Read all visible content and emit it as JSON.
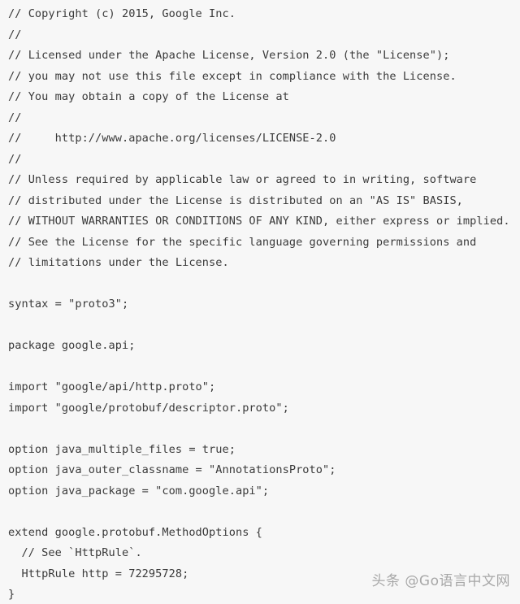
{
  "editor": {
    "language": "protobuf",
    "background_color": "#f7f7f7",
    "text_color": "#3a3a3a",
    "lines": [
      "// Copyright (c) 2015, Google Inc.",
      "//",
      "// Licensed under the Apache License, Version 2.0 (the \"License\");",
      "// you may not use this file except in compliance with the License.",
      "// You may obtain a copy of the License at",
      "//",
      "//     http://www.apache.org/licenses/LICENSE-2.0",
      "//",
      "// Unless required by applicable law or agreed to in writing, software",
      "// distributed under the License is distributed on an \"AS IS\" BASIS,",
      "// WITHOUT WARRANTIES OR CONDITIONS OF ANY KIND, either express or implied.",
      "// See the License for the specific language governing permissions and",
      "// limitations under the License.",
      "",
      "syntax = \"proto3\";",
      "",
      "package google.api;",
      "",
      "import \"google/api/http.proto\";",
      "import \"google/protobuf/descriptor.proto\";",
      "",
      "option java_multiple_files = true;",
      "option java_outer_classname = \"AnnotationsProto\";",
      "option java_package = \"com.google.api\";",
      "",
      "extend google.protobuf.MethodOptions {",
      "  // See `HttpRule`.",
      "  HttpRule http = 72295728;",
      "}"
    ]
  },
  "watermark": {
    "text": "头条 @Go语言中文网",
    "color": "#9a9a9a"
  }
}
